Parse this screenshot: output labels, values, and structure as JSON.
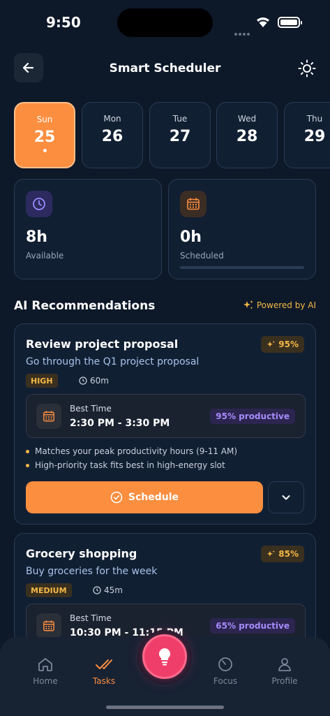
{
  "status_bar": {
    "time": "9:50"
  },
  "header": {
    "title": "Smart Scheduler"
  },
  "days": [
    {
      "name": "Sun",
      "num": "25",
      "active": true
    },
    {
      "name": "Mon",
      "num": "26"
    },
    {
      "name": "Tue",
      "num": "27"
    },
    {
      "name": "Wed",
      "num": "28"
    },
    {
      "name": "Thu",
      "num": "29"
    }
  ],
  "stats": {
    "available": {
      "value": "8h",
      "label": "Available"
    },
    "scheduled": {
      "value": "0h",
      "label": "Scheduled",
      "progress": 0
    }
  },
  "recommendations_section": {
    "title": "AI Recommendations",
    "powered_by": "Powered by AI"
  },
  "recommendations": [
    {
      "title": "Review project proposal",
      "score": "95%",
      "description": "Go through the Q1 project proposal",
      "priority": "HIGH",
      "duration": "60m",
      "best_time_label": "Best Time",
      "best_time": "2:30 PM - 3:30 PM",
      "productivity": "95% productive",
      "reasons": [
        "Matches your peak productivity hours (9-11 AM)",
        "High-priority task fits best in high-energy slot"
      ],
      "schedule_label": "Schedule"
    },
    {
      "title": "Grocery shopping",
      "score": "85%",
      "description": "Buy groceries for the week",
      "priority": "MEDIUM",
      "duration": "45m",
      "best_time_label": "Best Time",
      "best_time": "10:30 PM - 11:15 PM",
      "productivity": "65% productive"
    }
  ],
  "nav": {
    "home": "Home",
    "tasks": "Tasks",
    "focus": "Focus",
    "profile": "Profile",
    "active": "tasks"
  },
  "colors": {
    "accent": "#fb8e3f",
    "fab": "#f03e6a",
    "background": "#0d1829",
    "gold": "#f5b845",
    "purple": "#a78bfa"
  }
}
